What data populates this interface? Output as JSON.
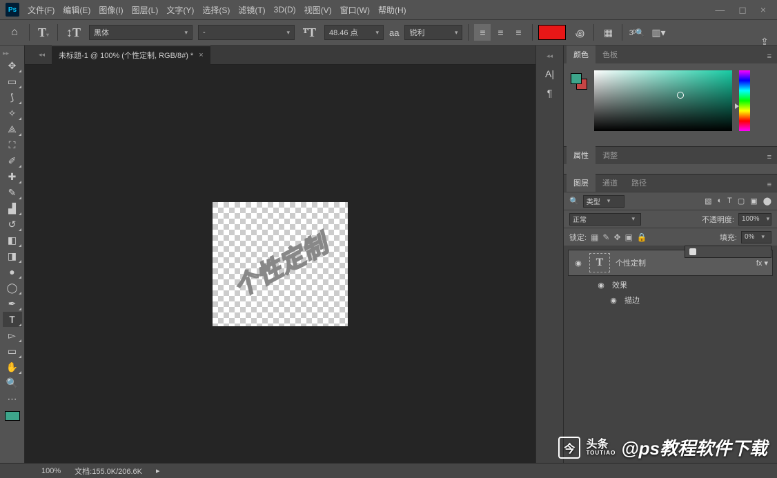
{
  "menu": [
    "文件(F)",
    "编辑(E)",
    "图像(I)",
    "图层(L)",
    "文字(Y)",
    "选择(S)",
    "滤镜(T)",
    "3D(D)",
    "视图(V)",
    "窗口(W)",
    "帮助(H)"
  ],
  "window_controls": "—  ◻  ×",
  "options": {
    "font_family": "黑体",
    "font_style": "-",
    "font_size": "48.46 点",
    "aa_label": "aa",
    "aa_mode": "锐利"
  },
  "doc_tab": "未标题-1 @ 100% (个性定制, RGB/8#) *",
  "canvas_text": "个性定制",
  "strip": {
    "char": "A|",
    "para": "¶"
  },
  "panels": {
    "color_tab": "颜色",
    "swatch_tab": "色板",
    "prop_tab": "属性",
    "adjust_tab": "调整",
    "layers_tab": "图层",
    "channels_tab": "通道",
    "paths_tab": "路径",
    "kind_label": "类型",
    "blend_mode": "正常",
    "opacity_label": "不透明度:",
    "opacity_value": "100%",
    "lock_label": "锁定:",
    "fill_label": "填充:",
    "fill_value": "0%",
    "layer_name": "个性定制",
    "fx_label": "效果",
    "stroke_label": "描边"
  },
  "status": {
    "zoom": "100%",
    "doc_label": "文档:",
    "doc_size": "155.0K/206.6K"
  },
  "tools": [
    "✥",
    "⬚",
    "✒",
    "◌",
    "✂",
    "▭",
    "◉",
    "✎",
    "⧉",
    "▤",
    "✏",
    "⇄",
    "◐",
    "▮",
    "●",
    "♜",
    "☟",
    "T",
    "◁",
    "▭",
    "✋",
    "🔍",
    "…"
  ],
  "watermark": {
    "brand1": "头条",
    "brand2": "TOUTIAO",
    "text": "@ps教程软件下载"
  }
}
